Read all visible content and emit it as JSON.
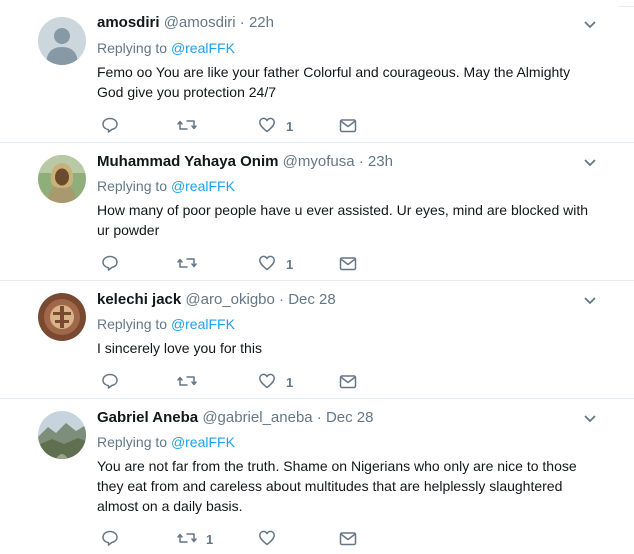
{
  "tweets": [
    {
      "name": "amosdiri",
      "handle": "@amosdiri",
      "sep": "·",
      "time": "22h",
      "replying_label": "Replying to",
      "replying_to": "@realFFK",
      "text": "Femo  oo You are like your father  Colorful and courageous. May the Almighty God give you protection 24/7",
      "retweets": "",
      "likes": "1",
      "avatar_icon": "default-avatar-icon"
    },
    {
      "name": "Muhammad Yahaya Onim",
      "handle": "@myofusa",
      "sep": "·",
      "time": "23h",
      "replying_label": "Replying to",
      "replying_to": "@realFFK",
      "text": "How many of poor people have u ever assisted. Ur eyes, mind are blocked with ur powder",
      "retweets": "",
      "likes": "1",
      "avatar_icon": "person-photo-avatar"
    },
    {
      "name": "kelechi jack",
      "handle": "@aro_okigbo",
      "sep": "·",
      "time": "Dec 28",
      "replying_label": "Replying to",
      "replying_to": "@realFFK",
      "text": "I sincerely love you for this",
      "retweets": "",
      "likes": "1",
      "avatar_icon": "emblem-photo-avatar"
    },
    {
      "name": "Gabriel Aneba",
      "handle": "@gabriel_aneba",
      "sep": "·",
      "time": "Dec 28",
      "replying_label": "Replying to",
      "replying_to": "@realFFK",
      "text": "You are not far from the truth. Shame on Nigerians who only are nice to those they eat from and careless about multitudes that are helplessly slaughtered almost on a daily basis.",
      "retweets": "1",
      "likes": "",
      "avatar_icon": "landscape-photo-avatar"
    }
  ],
  "icons": {
    "reply": "reply-icon",
    "retweet": "retweet-icon",
    "like": "heart-icon",
    "message": "direct-message-icon",
    "more": "chevron-down-icon"
  },
  "colors": {
    "name": "#14171a",
    "secondary": "#657786",
    "link": "#1da1f2",
    "divider": "#e6ecf0"
  }
}
